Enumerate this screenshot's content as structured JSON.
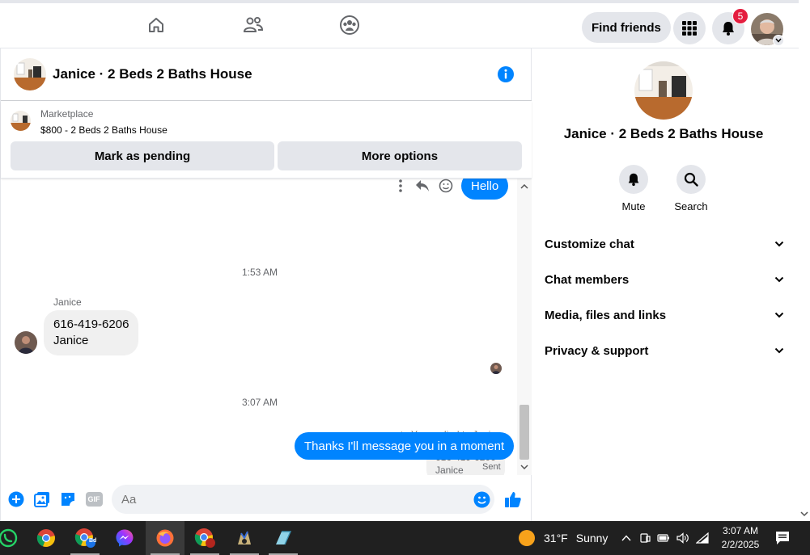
{
  "top_nav": {
    "find_friends_label": "Find friends",
    "notification_count": "5"
  },
  "chat": {
    "title": "Janice · 2 Beds 2 Baths House",
    "marketplace": {
      "label": "Marketplace",
      "listing": "$800 - 2 Beds 2 Baths House",
      "mark_pending_label": "Mark as pending",
      "more_options_label": "More options"
    },
    "messages": {
      "outgoing_hello": "Hello",
      "time_1": "1:53 AM",
      "incoming_sender": "Janice",
      "incoming_line1": "616-419-6206",
      "incoming_line2": "Janice",
      "time_2": "3:07 AM",
      "reply_note": "You replied to Janice",
      "quoted_line1": "616-419-6206",
      "quoted_line2": "Janice",
      "outgoing_reply": "Thanks I'll message you in a moment",
      "sent_status": "Sent"
    },
    "composer": {
      "placeholder": "Aa",
      "gif_label": "GIF"
    }
  },
  "info_panel": {
    "title": "Janice · 2 Beds 2 Baths House",
    "actions": [
      {
        "label": "Mute",
        "icon": "bell-icon"
      },
      {
        "label": "Search",
        "icon": "search-icon"
      }
    ],
    "sections": [
      {
        "label": "Customize chat"
      },
      {
        "label": "Chat members"
      },
      {
        "label": "Media, files and links"
      },
      {
        "label": "Privacy & support"
      }
    ]
  },
  "taskbar": {
    "weather_temp": "31°F",
    "weather_desc": "Sunny",
    "time": "3:07 AM",
    "date": "2/2/2025",
    "chrome_badge": "Bd"
  },
  "colors": {
    "accent": "#0084ff",
    "button_bg": "#e4e6eb",
    "badge_red": "#e41e3f",
    "taskbar_bg": "#202020"
  }
}
